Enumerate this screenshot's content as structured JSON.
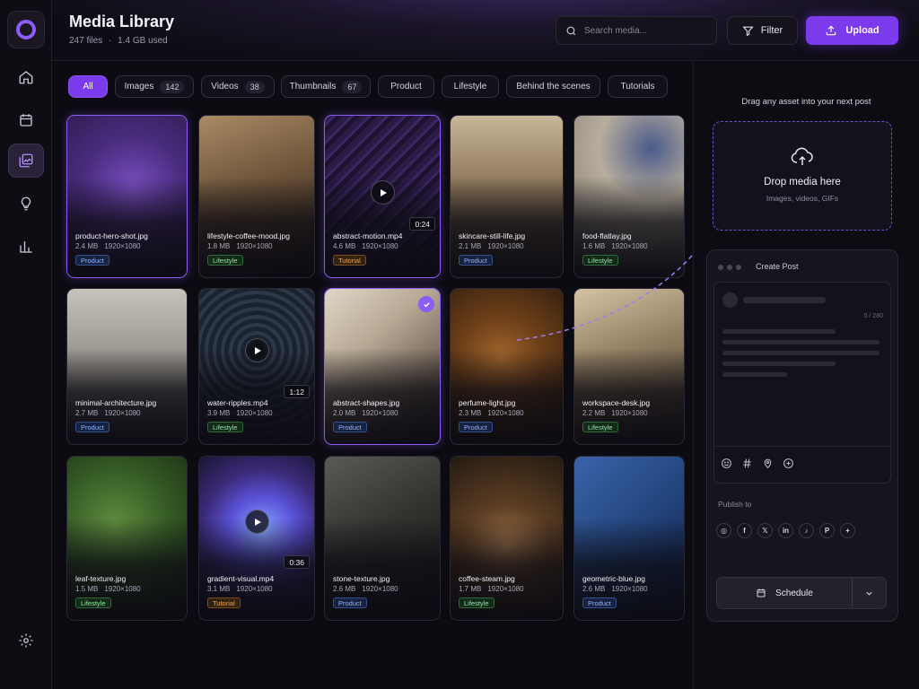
{
  "app": {
    "title": "Media Library",
    "summary_files": "247 files",
    "summary_sep": "·",
    "summary_storage": "1.4 GB used",
    "accent": "#7c3aed"
  },
  "sidebar": {
    "items": [
      {
        "name": "home",
        "icon": "home-icon"
      },
      {
        "name": "calendar",
        "icon": "calendar-icon"
      },
      {
        "name": "media",
        "icon": "media-library-icon",
        "active": true
      },
      {
        "name": "ideas",
        "icon": "lightbulb-icon"
      },
      {
        "name": "analytics",
        "icon": "bar-chart-icon"
      }
    ],
    "settings_icon": "gear-icon"
  },
  "header": {
    "search_placeholder": "Search media...",
    "filter_label": "Filter",
    "upload_label": "Upload"
  },
  "chips": [
    {
      "label": "All",
      "count": null,
      "active": true
    },
    {
      "label": "Images",
      "count": "142"
    },
    {
      "label": "Videos",
      "count": "38"
    },
    {
      "label": "Thumbnails",
      "count": "67"
    },
    {
      "label": "Product",
      "count": null
    },
    {
      "label": "Lifestyle",
      "count": null
    },
    {
      "label": "Behind the scenes",
      "count": null
    },
    {
      "label": "Tutorials",
      "count": null
    }
  ],
  "media": [
    {
      "name": "product-hero-shot.jpg",
      "size": "2.4 MB",
      "res": "1920×1080",
      "tag": "Product",
      "tagType": "product",
      "selected": true,
      "video": false
    },
    {
      "name": "lifestyle-coffee-mood.jpg",
      "size": "1.8 MB",
      "res": "1920×1080",
      "tag": "Lifestyle",
      "tagType": "lifestyle",
      "selected": false,
      "video": false
    },
    {
      "name": "abstract-motion.mp4",
      "size": "4.6 MB",
      "res": "1920×1080",
      "tag": "Tutorial",
      "tagType": "tutorial",
      "selected": true,
      "video": true,
      "duration": "0:24"
    },
    {
      "name": "skincare-still-life.jpg",
      "size": "2.1 MB",
      "res": "1920×1080",
      "tag": "Product",
      "tagType": "product",
      "selected": false,
      "video": false
    },
    {
      "name": "food-flatlay.jpg",
      "size": "1.6 MB",
      "res": "1920×1080",
      "tag": "Lifestyle",
      "tagType": "lifestyle",
      "selected": false,
      "video": false
    },
    {
      "name": "minimal-architecture.jpg",
      "size": "2.7 MB",
      "res": "1920×1080",
      "tag": "Product",
      "tagType": "product",
      "selected": false,
      "video": false
    },
    {
      "name": "water-ripples.mp4",
      "size": "3.9 MB",
      "res": "1920×1080",
      "tag": "Lifestyle",
      "tagType": "lifestyle",
      "selected": false,
      "video": true,
      "duration": "1:12"
    },
    {
      "name": "abstract-shapes.jpg",
      "size": "2.0 MB",
      "res": "1920×1080",
      "tag": "Product",
      "tagType": "product",
      "selected": true,
      "checked": true,
      "video": false
    },
    {
      "name": "perfume-light.jpg",
      "size": "2.3 MB",
      "res": "1920×1080",
      "tag": "Product",
      "tagType": "product",
      "selected": false,
      "video": false
    },
    {
      "name": "workspace-desk.jpg",
      "size": "2.2 MB",
      "res": "1920×1080",
      "tag": "Lifestyle",
      "tagType": "lifestyle",
      "selected": false,
      "video": false
    },
    {
      "name": "leaf-texture.jpg",
      "size": "1.5 MB",
      "res": "1920×1080",
      "tag": "Lifestyle",
      "tagType": "lifestyle",
      "selected": false,
      "video": false
    },
    {
      "name": "gradient-visual.mp4",
      "size": "3.1 MB",
      "res": "1920×1080",
      "tag": "Tutorial",
      "tagType": "tutorial",
      "selected": false,
      "video": true,
      "duration": "0:36"
    },
    {
      "name": "stone-texture.jpg",
      "size": "2.6 MB",
      "res": "1920×1080",
      "tag": "Product",
      "tagType": "product",
      "selected": false,
      "video": false
    },
    {
      "name": "coffee-steam.jpg",
      "size": "1.7 MB",
      "res": "1920×1080",
      "tag": "Lifestyle",
      "tagType": "lifestyle",
      "selected": false,
      "video": false
    },
    {
      "name": "geometric-blue.jpg",
      "size": "2.6 MB",
      "res": "1920×1080",
      "tag": "Product",
      "tagType": "product",
      "selected": false,
      "video": false
    }
  ],
  "panel": {
    "drag_hint": "Drag any asset into your next post",
    "drop_title": "Drop media here",
    "drop_sub": "Images, videos, GIFs",
    "post_title": "Create Post",
    "char_count": "0 / 280",
    "composer_icons": [
      "emoji-icon",
      "hashtag-icon",
      "location-pin-icon",
      "add-circle-icon"
    ],
    "publish_label": "Publish to",
    "socials": [
      {
        "name": "instagram-icon",
        "glyph": "◎"
      },
      {
        "name": "facebook-icon",
        "glyph": "f"
      },
      {
        "name": "x-icon",
        "glyph": "𝕏"
      },
      {
        "name": "linkedin-icon",
        "glyph": "in"
      },
      {
        "name": "tiktok-icon",
        "glyph": "♪"
      },
      {
        "name": "pinterest-icon",
        "glyph": "P"
      },
      {
        "name": "add-channel-icon",
        "glyph": "+"
      }
    ],
    "schedule_label": "Schedule"
  }
}
